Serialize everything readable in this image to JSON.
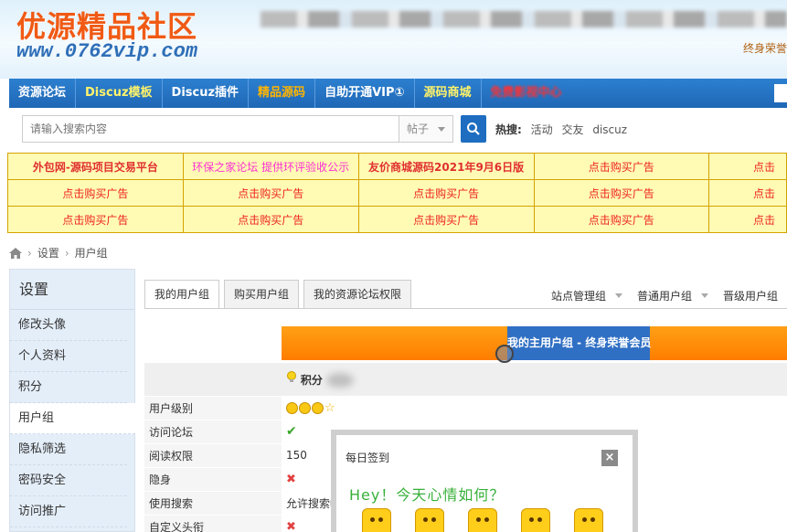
{
  "header": {
    "logo_text": "优源精品社区",
    "logo_url": "www.0762vip.com",
    "top_right_text": "终身荣誉"
  },
  "nav": {
    "items": [
      {
        "label": "资源论坛"
      },
      {
        "label": "Discuz模板"
      },
      {
        "label": "Discuz插件"
      },
      {
        "label": "精品源码"
      },
      {
        "label": "自助开通VIP①"
      },
      {
        "label": "源码商城"
      },
      {
        "label": "免费影视中心"
      }
    ]
  },
  "search": {
    "placeholder": "请输入搜索内容",
    "type_label": "帖子",
    "hot_label": "热搜:",
    "hot_terms": [
      "活动",
      "交友",
      "discuz"
    ]
  },
  "ads": {
    "rows": [
      [
        "外包网-源码项目交易平台",
        "环保之家论坛 提供环评验收公示",
        "友价商城源码2021年9月6日版",
        "点击购买广告",
        "点击"
      ],
      [
        "点击购买广告",
        "点击购买广告",
        "点击购买广告",
        "点击购买广告",
        "点击"
      ],
      [
        "点击购买广告",
        "点击购买广告",
        "点击购买广告",
        "点击购买广告",
        "点击"
      ]
    ]
  },
  "breadcrumb": {
    "items": [
      "设置",
      "用户组"
    ]
  },
  "sidebar": {
    "title": "设置",
    "items": [
      {
        "label": "修改头像"
      },
      {
        "label": "个人资料"
      },
      {
        "label": "积分"
      },
      {
        "label": "用户组"
      },
      {
        "label": "隐私筛选"
      },
      {
        "label": "密码安全"
      },
      {
        "label": "访问推广"
      }
    ]
  },
  "tabs": [
    {
      "label": "我的用户组"
    },
    {
      "label": "购买用户组"
    },
    {
      "label": "我的资源论坛权限"
    }
  ],
  "filters": [
    "站点管理组",
    "普通用户组",
    "晋级用户组"
  ],
  "group": {
    "main_group_label": "我的主用户组 - 终身荣誉会员",
    "points_label": "积分"
  },
  "permissions": [
    {
      "label": "用户级别",
      "value": ""
    },
    {
      "label": "访问论坛",
      "value": "✔"
    },
    {
      "label": "阅读权限",
      "value": "150"
    },
    {
      "label": "隐身",
      "value": "✖"
    },
    {
      "label": "使用搜索",
      "value": "允许搜索帖"
    },
    {
      "label": "自定义头衔",
      "value": "✖"
    }
  ],
  "popup": {
    "title": "每日签到",
    "close_label": "×",
    "greeting": "Hey！今天心情如何？"
  }
}
